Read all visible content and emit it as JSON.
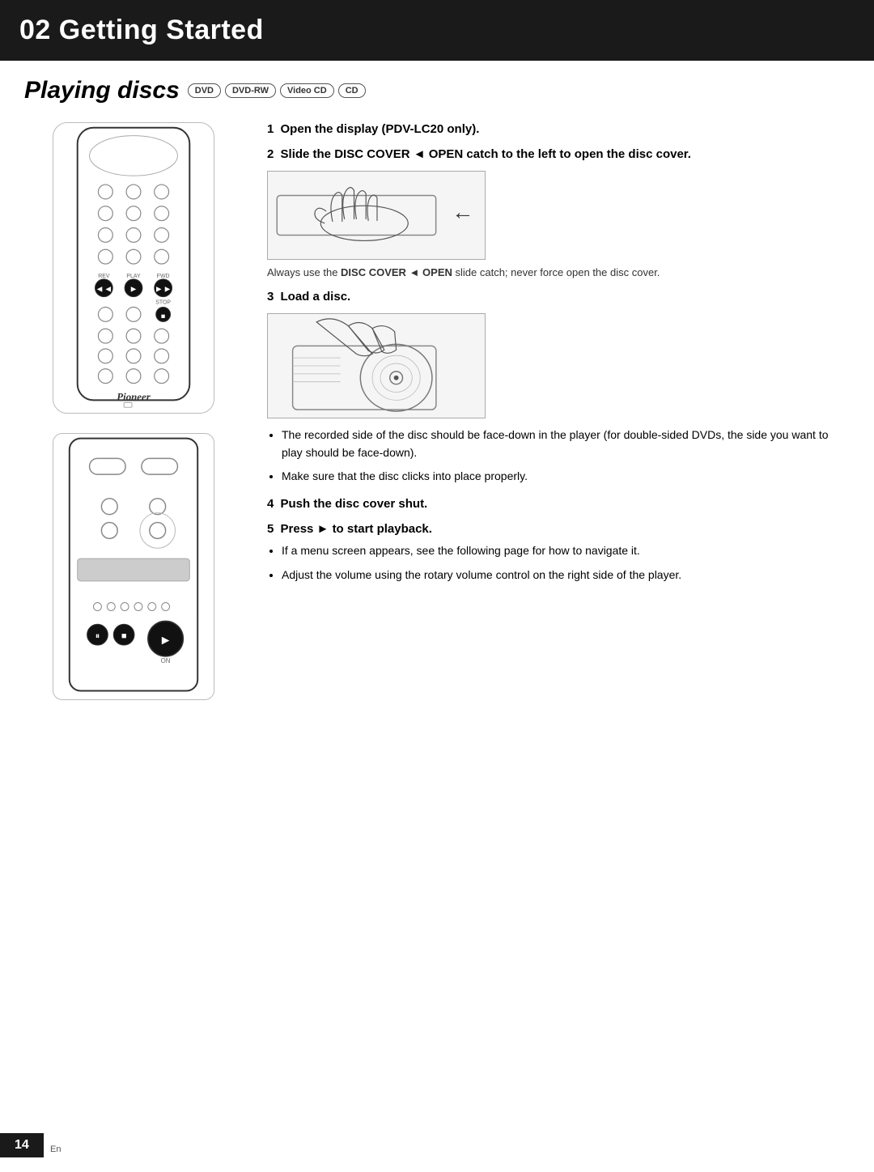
{
  "header": {
    "chapter": "02 Getting Started"
  },
  "section": {
    "title": "Playing discs",
    "badges": [
      "DVD",
      "DVD-RW",
      "Video CD",
      "CD"
    ]
  },
  "steps": [
    {
      "number": "1",
      "text": "Open the display (PDV-LC20 only)."
    },
    {
      "number": "2",
      "text": "Slide the DISC COVER ◄ OPEN catch to the left to open the disc cover."
    },
    {
      "number": "3",
      "text": "Load a disc."
    },
    {
      "number": "4",
      "text": "Push the disc cover shut."
    },
    {
      "number": "5",
      "text": "Press ► to start playback."
    }
  ],
  "notes": {
    "disc_cover_note": "Always use the DISC COVER ◄ OPEN slide catch; never force open the disc cover.",
    "disc_cover_bold": "DISC COVER ◄ OPEN"
  },
  "bullets": {
    "step3": [
      "The recorded side of the disc should be face-down in the player (for double-sided DVDs, the side you want to play should be face-down).",
      "Make sure that the disc clicks into place properly."
    ],
    "step5": [
      "If a menu screen appears, see the following page for how to navigate it.",
      "Adjust the volume using the rotary volume control on the right side of the player."
    ]
  },
  "page": {
    "number": "14",
    "lang": "En"
  }
}
